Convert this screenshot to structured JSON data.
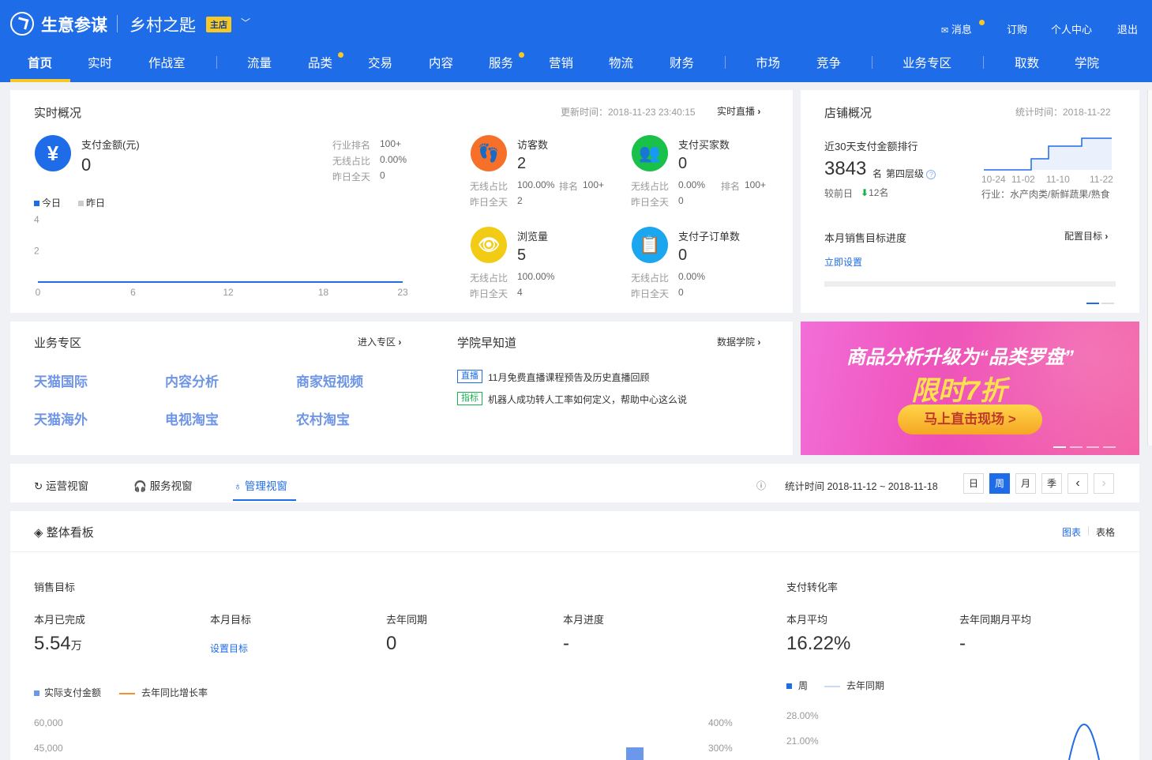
{
  "topbar": {
    "brand": "生意参谋",
    "shop_name": "乡村之匙",
    "shop_badge": "主店",
    "links": [
      "消息",
      "订购",
      "个人中心",
      "退出"
    ]
  },
  "nav": [
    "首页",
    "实时",
    "作战室",
    "流量",
    "品类",
    "交易",
    "内容",
    "服务",
    "营销",
    "物流",
    "财务",
    "市场",
    "竞争",
    "业务专区",
    "取数",
    "学院"
  ],
  "realtime": {
    "title": "实时概况",
    "update_time": "更新时间：2018-11-23 23:40:15",
    "live_link": "实时直播",
    "pay_amount_label": "支付金额(元)",
    "pay_amount_value": "0",
    "industry_rank_label": "行业排名",
    "industry_rank_value": "100+",
    "wireless_label": "无线占比",
    "wireless_value": "0.00%",
    "yesterday_label": "昨日全天",
    "yesterday_value": "0",
    "legend_today": "今日",
    "legend_yesterday": "昨日",
    "chart_data": {
      "type": "line",
      "x": [
        0,
        6,
        12,
        18,
        23
      ],
      "series": [
        {
          "name": "今日",
          "values": [
            0,
            0,
            0,
            0,
            0
          ]
        }
      ],
      "y_ticks": [
        "4",
        "2"
      ],
      "x_ticks": [
        "0",
        "6",
        "12",
        "18",
        "23"
      ],
      "ylim": [
        0,
        4
      ]
    },
    "visitors": {
      "label": "访客数",
      "value": "2",
      "wireless_label": "无线占比",
      "wireless_value": "100.00%",
      "rank_label": "排名",
      "rank_value": "100+",
      "yesterday_label": "昨日全天",
      "yesterday_value": "2"
    },
    "buyers": {
      "label": "支付买家数",
      "value": "0",
      "wireless_label": "无线占比",
      "wireless_value": "0.00%",
      "rank_label": "排名",
      "rank_value": "100+",
      "yesterday_label": "昨日全天",
      "yesterday_value": "0"
    },
    "pageviews": {
      "label": "浏览量",
      "value": "5",
      "wireless_label": "无线占比",
      "wireless_value": "100.00%",
      "yesterday_label": "昨日全天",
      "yesterday_value": "4"
    },
    "suborders": {
      "label": "支付子订单数",
      "value": "0",
      "wireless_label": "无线占比",
      "wireless_value": "0.00%",
      "yesterday_label": "昨日全天",
      "yesterday_value": "0"
    }
  },
  "shop_overview": {
    "title": "店铺概况",
    "stat_time": "统计时间：2018-11-22",
    "rank_label": "近30天支付金额排行",
    "rank_value": "3843",
    "rank_unit": "名",
    "level": "第四层级",
    "compare_label": "较前日",
    "compare_value": "12名",
    "chart_dates": [
      "10-24",
      "11-02",
      "11-10",
      "11-22"
    ],
    "industry": "行业：水产肉类/新鲜蔬果/熟食",
    "sales_target_label": "本月销售目标进度",
    "config_target": "配置目标",
    "set_now": "立即设置"
  },
  "business": {
    "title": "业务专区",
    "enter": "进入专区",
    "links": [
      "天猫国际",
      "内容分析",
      "商家短视频",
      "天猫海外",
      "电视淘宝",
      "农村淘宝"
    ]
  },
  "academy": {
    "title": "学院早知道",
    "more": "数据学院",
    "items": [
      {
        "tag": "直播",
        "text": "11月免费直播课程预告及历史直播回顾"
      },
      {
        "tag": "指标",
        "text": "机器人成功转人工率如何定义，帮助中心这么说"
      }
    ]
  },
  "banner": {
    "line1": "商品分析升级为“品类罗盘”",
    "line2": "限时7折",
    "button": "马上直击现场 >"
  },
  "view_tabs": {
    "tabs": [
      "运营视窗",
      "服务视窗",
      "管理视窗"
    ],
    "stat_time": "统计时间 2018-11-12 ~ 2018-11-18",
    "periods": [
      "日",
      "周",
      "月",
      "季"
    ],
    "prev": "‹",
    "next": "›"
  },
  "dashboard": {
    "title": "整体看板",
    "mode_chart": "图表",
    "mode_table": "表格",
    "sales_target_title": "销售目标",
    "metrics": [
      {
        "label": "本月已完成",
        "value": "5.54",
        "unit": "万"
      },
      {
        "label": "本月目标",
        "value": "设置目标"
      },
      {
        "label": "去年同期",
        "value": "0"
      },
      {
        "label": "本月进度",
        "value": "-"
      }
    ],
    "legend_actual": "实际支付金额",
    "legend_growth": "去年同比增长率",
    "left_y_ticks": [
      "60,000",
      "45,000"
    ],
    "right_y_ticks": [
      "400%",
      "300%"
    ],
    "conversion_title": "支付转化率",
    "conversion_metrics": [
      {
        "label": "本月平均",
        "value": "16.22%"
      },
      {
        "label": "去年同期月平均",
        "value": "-"
      }
    ],
    "legend_week": "周",
    "legend_last_year": "去年同期",
    "conv_y_ticks": [
      "28.00%",
      "21.00%"
    ]
  },
  "colors": {
    "primary": "#1f6ce8",
    "accent": "#f7c928",
    "orange": "#f7702a",
    "green": "#19c04a",
    "yellow": "#f2cc14",
    "cyan": "#1aa7f0"
  }
}
